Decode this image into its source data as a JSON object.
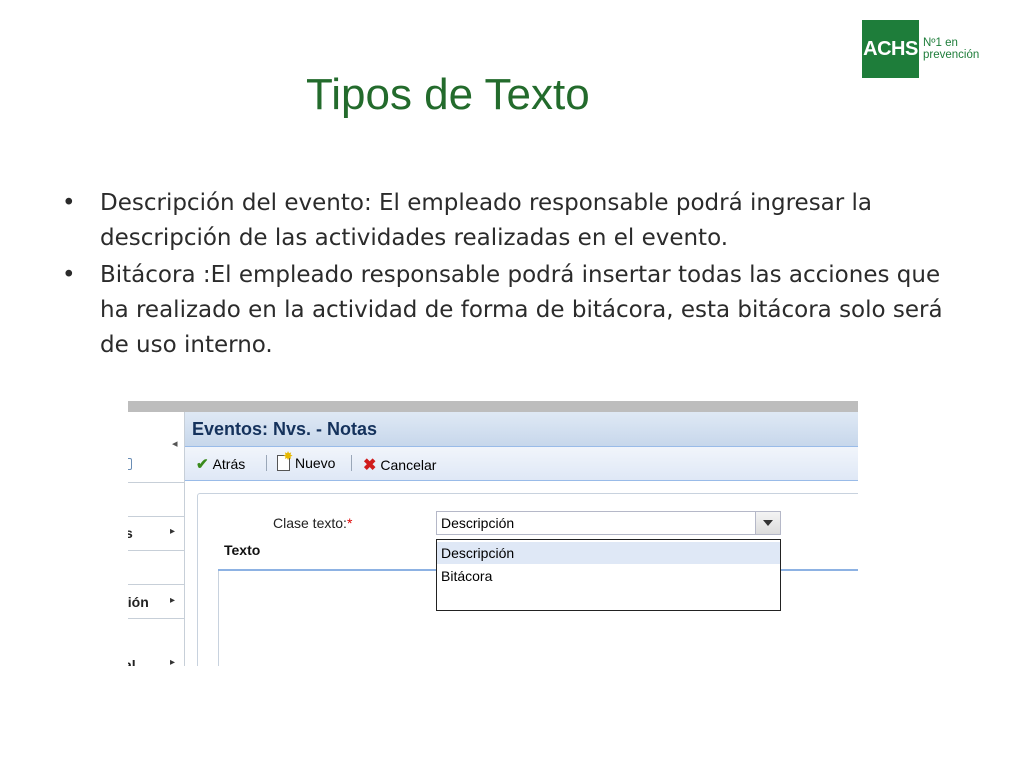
{
  "logo": {
    "brand": "ACHS",
    "tagline_line1": "Nº1 en",
    "tagline_line2": "prevención"
  },
  "slide": {
    "title": "Tipos de Texto",
    "bullet_char": "•",
    "bullets": [
      "Descripción del evento: El empleado responsable podrá ingresar la descripción de las actividades realizadas en el evento.",
      "Bitácora :El empleado responsable podrá insertar todas las acciones que ha realizado en la actividad de forma de bitácora, esta bitácora solo será de uso interno."
    ]
  },
  "app": {
    "panel_title": "Eventos: Nvs. - Notas",
    "toolbar": {
      "back": "Atrás",
      "new": "Nuevo",
      "cancel": "Cancelar"
    },
    "collapse_glyph": "◂",
    "nav": [
      {
        "label": "s",
        "arrow": "▸"
      },
      {
        "label": "ción",
        "arrow": "▸"
      },
      {
        "label": "al",
        "arrow": "▸"
      }
    ],
    "form": {
      "clase_label": "Clase texto:",
      "required_mark": "*",
      "clase_value": "Descripción",
      "texto_label": "Texto",
      "options": [
        "Descripción",
        "Bitácora"
      ],
      "selected_option": "Descripción"
    }
  },
  "colors": {
    "title": "#236b2c",
    "brand": "#1e7d3a",
    "panel_header": "#c7d7eb",
    "selection": "#dfe8f6"
  }
}
